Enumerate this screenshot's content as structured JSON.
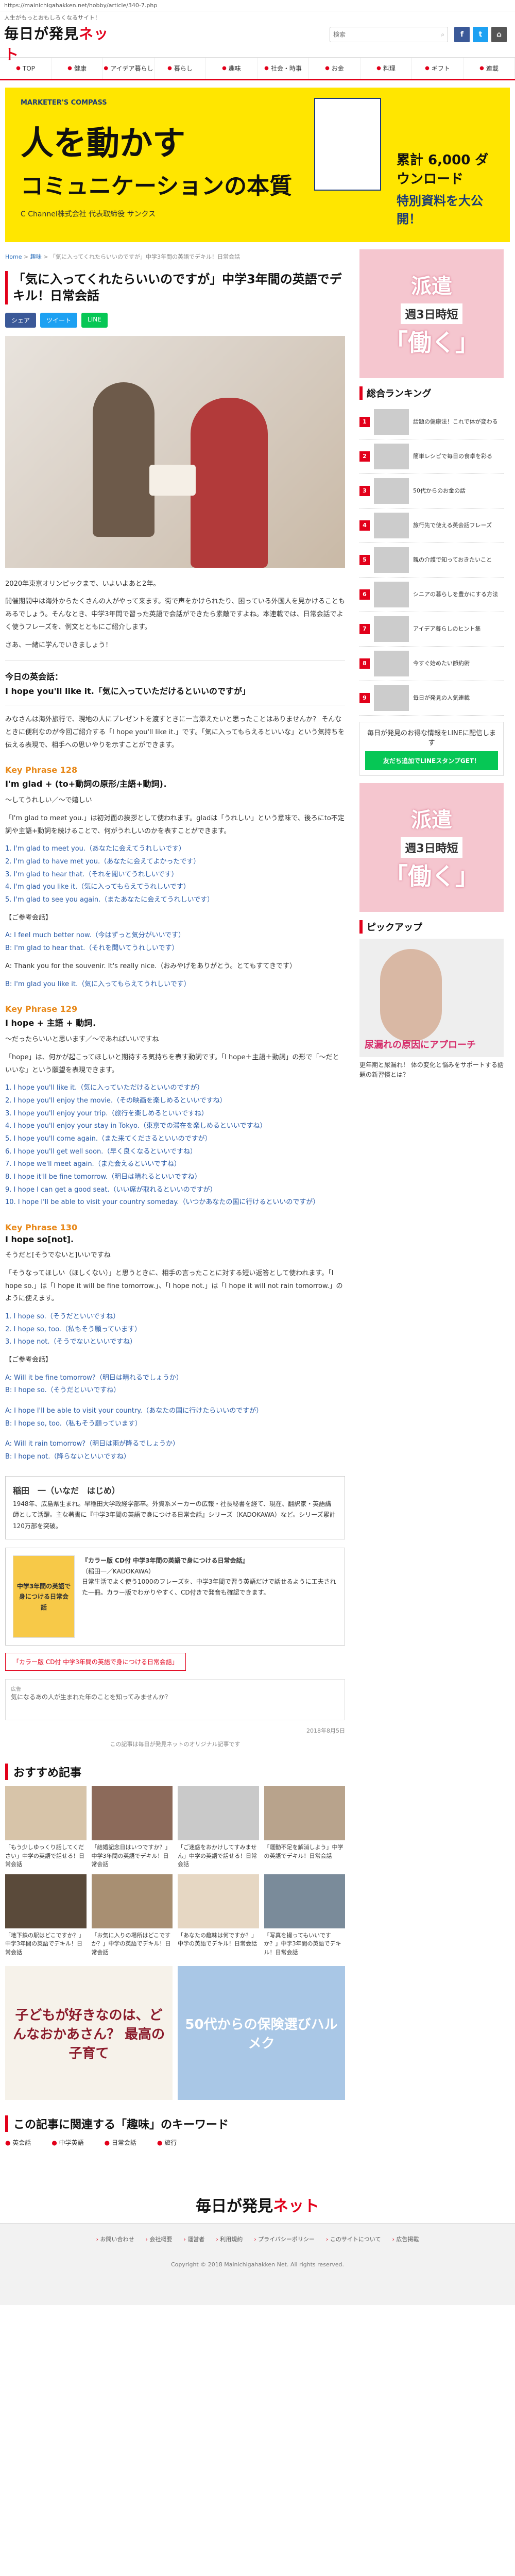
{
  "browser": {
    "url": "https://mainichigahakken.net/hobby/article/340-7.php"
  },
  "header": {
    "tagline": "人生がもっとおもしろくなるサイト！",
    "logo_main": "毎日が発見",
    "logo_net": "ネット",
    "search_placeholder": "検索",
    "social": [
      {
        "label": "f",
        "color": "#3b5998",
        "icon": "facebook-icon"
      },
      {
        "label": "t",
        "color": "#1da1f2",
        "icon": "twitter-icon"
      },
      {
        "label": "⌂",
        "color": "#555555",
        "icon": "rss-icon"
      }
    ]
  },
  "nav": [
    "TOP",
    "健康",
    "アイデア暮らし",
    "暮らし",
    "趣味",
    "社会・時事",
    "お金",
    "料理",
    "ギフト",
    "連載"
  ],
  "banner": {
    "small": "MARKETER'S COMPASS",
    "title": "人を動かす",
    "title2": "コミュニケーションの本質",
    "author": "C Channel株式会社 代表取締役 サンクス",
    "count": "累計 6,000 ダウンロード",
    "cta": "特別資料を大公開！"
  },
  "breadcrumb": {
    "home": "Home",
    "section": "趣味",
    "current": "「気に入ってくれたらいいのですが」中学3年間の英語でデキル！日常会話"
  },
  "article": {
    "title": "「気に入ってくれたらいいのですが」中学3年間の英語でデキル！日常会話",
    "share": [
      {
        "label": "シェア",
        "color": "#3b5998"
      },
      {
        "label": "ツイート",
        "color": "#1da1f2"
      },
      {
        "label": "LINE",
        "color": "#06c755"
      }
    ],
    "intro1": "2020年東京オリンピックまで、いよいよあと2年。",
    "intro2": "開催期間中は海外からたくさんの人がやって来ます。街で声をかけられたり、困っている外国人を見かけることもあるでしょう。そんなとき、中学3年間で習った英語で会話ができたら素敵ですよね。本連載では、日常会話でよく使うフレーズを、例文とともにご紹介します。",
    "intro3": "さあ、一緒に学んでいきましょう！",
    "today_title": "今日の英会話：",
    "today_phrase": "I hope you'll like it.「気に入っていただけるといいのですが」",
    "explain": "みなさんは海外旅行で、現地の人にプレゼントを渡すときに一言添えたいと思ったことはありませんか？ そんなときに便利なのが今回ご紹介する「I hope you'll like it.」です。「気に入ってもらえるといいな」という気持ちを伝える表現で、相手への思いやりを示すことができます。",
    "kp1_label": "Key Phrase 128",
    "kp1_title": "I'm glad + (to+動詞の原形/主語+動詞)．",
    "kp1_meaning": "〜してうれしい／〜で嬉しい",
    "kp1_desc": "「I'm glad to meet you.」は初対面の挨拶として使われます。gladは「うれしい」という意味で、後ろにto不定詞や主語+動詞を続けることで、何がうれしいのかを表すことができます。",
    "kp1_examples": [
      "1. I'm glad to meet you.（あなたに会えてうれしいです）",
      "2. I'm glad to have met you.（あなたに会えてよかったです）",
      "3. I'm glad to hear that.（それを聞いてうれしいです）",
      "4. I'm glad you like it.（気に入ってもらえてうれしいです）",
      "5. I'm glad to see you again.（またあなたに会えてうれしいです）"
    ],
    "kp1_dialog_title": "【ご参考会話】",
    "kp1_dialog": [
      "A: I feel much better now.（今はずっと気分がいいです）",
      "B: I'm glad to hear that.（それを聞いてうれしいです）"
    ],
    "kp1_note": "A: Thank you for the souvenir. It's really nice.（おみやげをありがとう。とてもすてきです）",
    "kp1_note2": "B: I'm glad you like it.（気に入ってもらえてうれしいです）",
    "kp2_label": "Key Phrase 129",
    "kp2_title": "I hope + 主語 + 動詞．",
    "kp2_meaning": "〜だったらいいと思います／〜であればいいですね",
    "kp2_desc": "「hope」は、何かが起こってほしいと期待する気持ちを表す動詞です。「I hope＋主語＋動詞」の形で「〜だといいな」という願望を表現できます。",
    "kp2_examples": [
      "1. I hope you'll like it.（気に入っていただけるといいのですが）",
      "2. I hope you'll enjoy the movie.（その映画を楽しめるといいですね）",
      "3. I hope you'll enjoy your trip.（旅行を楽しめるといいですね）",
      "4. I hope you'll enjoy your stay in Tokyo.（東京での滞在を楽しめるといいですね）",
      "5. I hope you'll come again.（また来てくださるといいのですが）",
      "6. I hope you'll get well soon.（早く良くなるといいですね）",
      "7. I hope we'll meet again.（また会えるといいですね）",
      "8. I hope it'll be fine tomorrow.（明日は晴れるといいですね）",
      "9. I hope I can get a good seat.（いい席が取れるといいのですが）",
      "10. I hope I'll be able to visit your country someday.（いつかあなたの国に行けるといいのですが）"
    ],
    "kp3_label": "Key Phrase 130",
    "kp3_title": "I hope so[not].",
    "kp3_meaning": "そうだと[そうでないと]いいですね",
    "kp3_desc": "「そうなってほしい（ほしくない）」と思うときに、相手の言ったことに対する短い返答として使われます。「I hope so.」は「I hope it will be fine tomorrow.」、「I hope not.」は「I hope it will not rain tomorrow.」のように使えます。",
    "kp3_examples": [
      "1. I hope so.（そうだといいですね）",
      "2. I hope so, too.（私もそう願っています）",
      "3. I hope not.（そうでないといいですね）"
    ],
    "kp3_dialog_title": "【ご参考会話】",
    "kp3_dialog": [
      "A: Will it be fine tomorrow?（明日は晴れるでしょうか）",
      "B: I hope so.（そうだといいですね）"
    ],
    "kp3_dialog2": [
      "A: I hope I'll be able to visit your country.（あなたの国に行けたらいいのですが）",
      "B: I hope so, too.（私もそう願っています）"
    ],
    "kp3_dialog3": [
      "A: Will it rain tomorrow?（明日は雨が降るでしょうか）",
      "B: I hope not.（降らないといいですね）"
    ]
  },
  "profile": {
    "name": "稲田　一（いなだ　はじめ）",
    "bio": "1948年、広島県生まれ。早稲田大学政経学部卒。外資系メーカーの広報・社長秘書を経て、現在、翻訳家・英語講師として活躍。主な著書に『中学3年間の英語で身につける日常会話』シリーズ（KADOKAWA）など。シリーズ累計120万部を突破。"
  },
  "book": {
    "cover_text": "中学3年間の英語で身につける日常会話",
    "title": "『カラー版 CD付 中学3年間の英語で身につける日常会話』",
    "author": "（稲田一／KADOKAWA）",
    "desc": "日常生活でよく使う1000のフレーズを、中学3年間で習う英語だけで話せるように工夫された一冊。カラー版でわかりやすく、CD付きで発音も確認できます。",
    "link": "「カラー版 CD付 中学3年間の英語で身につける日常会話」"
  },
  "ad_text": "広告",
  "ad_body": "気になるあの人が生まれた年のことを知ってみませんか？",
  "date": "2018年8月5日",
  "foot_note": "この記事は毎日が発見ネットのオリジナル記事です",
  "recommend": {
    "title": "おすすめ記事",
    "items": [
      {
        "text": "「もう少しゆっくり話してください」中学の英語で話せる！日常会話",
        "color": "#d7c4a9"
      },
      {
        "text": "「結婚記念日はいつですか？」中学3年間の英語でデキル！日常会話",
        "color": "#8c6a5a"
      },
      {
        "text": "「ご迷惑をおかけしてすみません」中学の英語で話せる！日常会話",
        "color": "#c9c9c9"
      },
      {
        "text": "「運動不足を解消しよう」中学の英語でデキル！日常会話",
        "color": "#b8a38c"
      },
      {
        "text": "「地下鉄の駅はどこですか？」中学3年間の英語でデキル！日常会話",
        "color": "#5a4a3a"
      },
      {
        "text": "「お気に入りの場所はどこですか？」中学の英語でデキル！日常会話",
        "color": "#a88f72"
      },
      {
        "text": "「あなたの趣味は何ですか？」中学の英語でデキル！日常会話",
        "color": "#e6d7c3"
      },
      {
        "text": "「写真を撮ってもいいですか？」中学3年間の英語でデキル！日常会話",
        "color": "#7a8b9a"
      }
    ]
  },
  "pr": [
    {
      "text": "子どもが好きなのは、どんなおかあさん？ 最高の子育て",
      "bg": "#f6f2ea",
      "color": "#8a1a2a"
    },
    {
      "text": "50代からの保険選びハルメク",
      "bg": "#a9c7e6",
      "color": "#ffffff"
    }
  ],
  "keywords": {
    "title": "この記事に関連する「趣味」のキーワード",
    "items": [
      "英会話",
      "中学英語",
      "日常会話",
      "旅行"
    ]
  },
  "footer": {
    "logo_main": "毎日が発見",
    "logo_net": "ネット",
    "nav": [
      "お問い合わせ",
      "会社概要",
      "運営者",
      "利用規約",
      "プライバシーポリシー",
      "このサイトについて",
      "広告掲載"
    ],
    "copyright": "Copyright © 2018 Mainichigahakken Net. All rights reserved."
  },
  "side": {
    "ad_line1": "派遣",
    "ad_line2": "週3日時短",
    "ad_line3": "「働く」",
    "ranking_title": "総合ランキング",
    "ranking": [
      "話題の健康法！これで体が変わる",
      "簡単レシピで毎日の食卓を彩る",
      "50代からのお金の話",
      "旅行先で使える英会話フレーズ",
      "親の介護で知っておきたいこと",
      "シニアの暮らしを豊かにする方法",
      "アイデア暮らしのヒント集",
      "今すぐ始めたい節約術",
      "毎日が発見の人気連載"
    ],
    "line_text": "毎日が発見のお得な情報をLINEに配信します",
    "line_btn": "友だち追加でLINEスタンプGET！",
    "pickup_title": "ピックアップ",
    "pickup_caption": "尿漏れの原因にアプローチ",
    "pickup_text": "更年期と尿漏れ！ 体の変化と悩みをサポートする話題の新習慣とは？"
  }
}
